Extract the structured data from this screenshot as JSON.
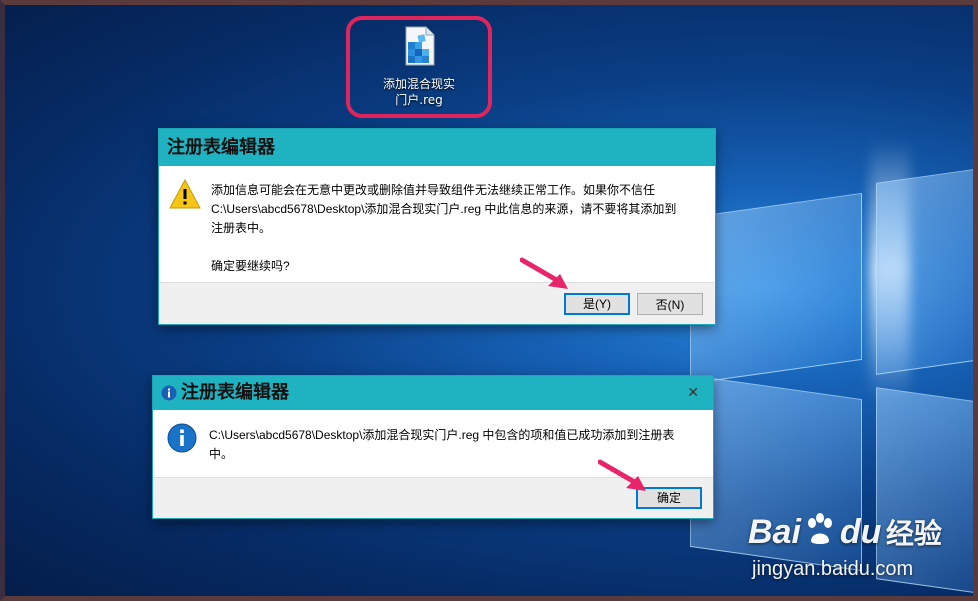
{
  "desktop": {
    "icon_label_line1": "添加混合现实",
    "icon_label_line2": "门户.reg"
  },
  "dialog_warning": {
    "title": "注册表编辑器",
    "line1": "添加信息可能会在无意中更改或删除值并导致组件无法继续正常工作。如果你不信任",
    "line2": "C:\\Users\\abcd5678\\Desktop\\添加混合现实门户.reg 中此信息的来源，请不要将其添加到",
    "line3": "注册表中。",
    "question": "确定要继续吗?",
    "yes_label": "是(Y)",
    "no_label": "否(N)"
  },
  "dialog_info": {
    "title": "注册表编辑器",
    "line1": "C:\\Users\\abcd5678\\Desktop\\添加混合现实门户.reg 中包含的项和值已成功添加到注册表",
    "line2": "中。",
    "ok_label": "确定",
    "close_glyph": "✕"
  },
  "watermark": {
    "brand_left": "Bai",
    "brand_right": "du",
    "brand_cn": "经验",
    "url": "jingyan.baidu.com"
  },
  "colors": {
    "accent": "#1fb3c1",
    "highlight": "#e0245e",
    "default_button_border": "#0078d7"
  }
}
